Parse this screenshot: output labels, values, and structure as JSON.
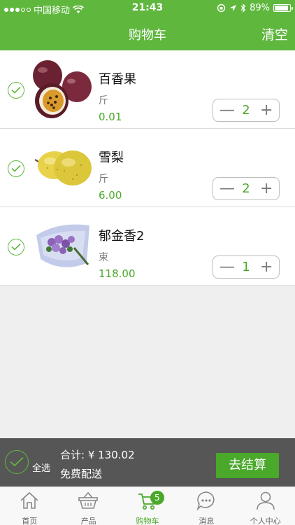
{
  "status_bar": {
    "carrier": "中国移动",
    "time": "21:43",
    "battery": "89%",
    "battery_level": 0.89
  },
  "header": {
    "title": "购物车",
    "clear_label": "清空"
  },
  "cart": {
    "items": [
      {
        "name": "百香果",
        "unit": "斤",
        "price": "0.01",
        "quantity": "2",
        "image": "passion-fruit"
      },
      {
        "name": "雪梨",
        "unit": "斤",
        "price": "6.00",
        "quantity": "2",
        "image": "snow-pear"
      },
      {
        "name": "郁金香2",
        "unit": "束",
        "price": "118.00",
        "quantity": "1",
        "image": "tulip-bouquet"
      }
    ]
  },
  "checkout": {
    "select_all_label": "全选",
    "total_label": "合计: ¥ 130.02",
    "shipping_label": "免费配送",
    "checkout_button": "去结算"
  },
  "tabbar": {
    "tabs": [
      {
        "label": "首页",
        "icon": "home-icon"
      },
      {
        "label": "产品",
        "icon": "basket-icon"
      },
      {
        "label": "购物车",
        "icon": "cart-icon",
        "badge": "5",
        "active": true
      },
      {
        "label": "消息",
        "icon": "message-icon"
      },
      {
        "label": "个人中心",
        "icon": "user-icon"
      }
    ]
  },
  "colors": {
    "brand_green": "#5fb73e",
    "price_green": "#4aa82a",
    "checkout_bar": "#565656"
  }
}
